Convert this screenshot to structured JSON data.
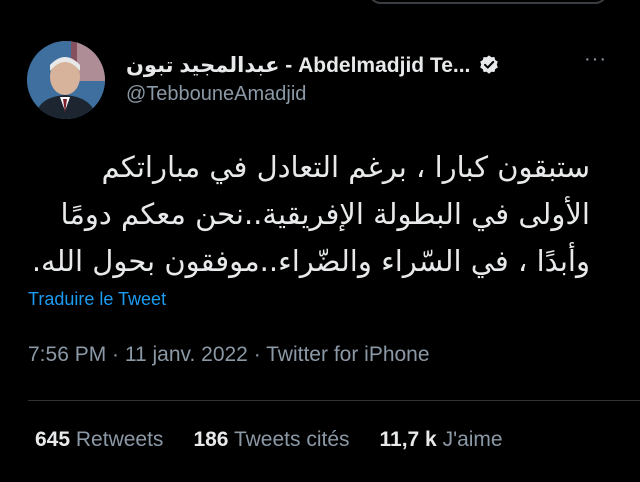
{
  "author": {
    "display_name": "عبدالمجيد تبون - Abdelmadjid Te...",
    "handle": "@TebbouneAmadjid",
    "verified_icon": "verified-badge-icon",
    "avatar_icon": "avatar-photo"
  },
  "more_icon": "···",
  "tweet": {
    "lines": [
      "ستبقون كبارا ، برغم التعادل في مباراتكم",
      "الأولى في البطولة الإفريقية..نحن معكم دومًا",
      "وأبدًا ، في السّراء والضّراء..موفقون بحول الله."
    ]
  },
  "translate_label": "Traduire le Tweet",
  "meta": "7:56 PM · 11 janv. 2022 · Twitter for iPhone",
  "stats": {
    "retweets_count": "645",
    "retweets_label": "Retweets",
    "quotes_count": "186",
    "quotes_label": "Tweets cités",
    "likes_count": "11,7 k",
    "likes_label": "J'aime"
  },
  "colors": {
    "background": "#000000",
    "text": "#e7e9ea",
    "secondary": "#8b98a5",
    "link": "#1d9bf0",
    "divider": "#2f3336"
  }
}
